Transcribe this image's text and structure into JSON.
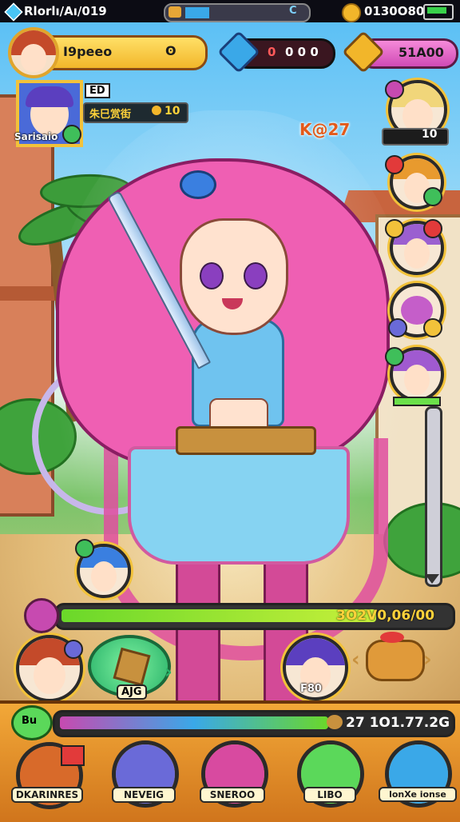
{
  "top_bar": {
    "title": "Rlorlı/Aı/019",
    "center_label": "C",
    "currency_value": "0130O80"
  },
  "player_banner": {
    "name": "I9peeo",
    "level_indicator": "ʘ"
  },
  "gems_pill": {
    "value": "0 0 0",
    "prefix": "0"
  },
  "gold_pill": {
    "value": "51A00"
  },
  "hero_card": {
    "tag": "ED",
    "name": "Sarisaio",
    "title": "朱巳赏街",
    "count": "10"
  },
  "combo_label": "K@27",
  "party": [
    {
      "name": "party-member-1",
      "level": "10",
      "hair": "#f1d67a"
    },
    {
      "name": "party-member-2",
      "level": "",
      "hair": "#e89a2e"
    },
    {
      "name": "party-member-3",
      "level": "",
      "hair": "#9b5fd0"
    },
    {
      "name": "party-member-4",
      "level": "",
      "hair": "#c55ec9"
    },
    {
      "name": "party-member-5",
      "level": "",
      "hair": "#a05ad0"
    }
  ],
  "exp_bar": {
    "value_text": "3O2V0,06/00",
    "fill_fraction": 0.82
  },
  "actions": {
    "left_skill_label": "AJG",
    "right_unit_label": "F80"
  },
  "second_bar": {
    "value_text": "27  1O1.77.2G",
    "fill_fraction": 0.7,
    "prefix": "Bu"
  },
  "nav": [
    {
      "label": "DKARINRES",
      "color": "#d86a2a"
    },
    {
      "label": "NEVEIG",
      "color": "#6a6ad8"
    },
    {
      "label": "SNEROO",
      "color": "#d84aa0"
    },
    {
      "label": "LIBO",
      "color": "#5bd85a"
    },
    {
      "label": "lonXe ionse",
      "color": "#3aa8e8"
    }
  ],
  "colors": {
    "accent_pink": "#ef5fb3",
    "accent_gold": "#f2b62a",
    "exp_green": "#9be024"
  }
}
